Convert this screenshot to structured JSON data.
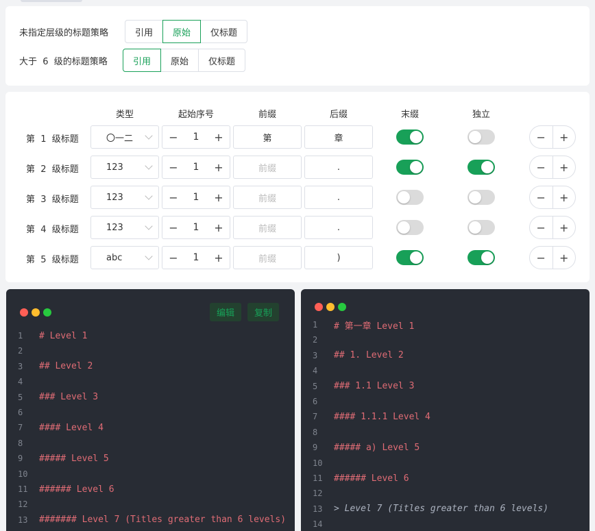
{
  "heading_strategy": {
    "unspecified": {
      "label": "未指定层级的标题策略",
      "options": [
        "引用",
        "原始",
        "仅标题"
      ],
      "selected": "原始"
    },
    "beyond6": {
      "label": "大于  6  级的标题策略",
      "options": [
        "引用",
        "原始",
        "仅标题"
      ],
      "selected": "引用"
    }
  },
  "table": {
    "headers": {
      "type": "类型",
      "start": "起始序号",
      "prefix": "前缀",
      "suffix": "后缀",
      "trailing": "末缀",
      "independent": "独立"
    },
    "rows": [
      {
        "label": "第  1  级标题",
        "type": "〇一二",
        "start": "1",
        "prefix": "第",
        "prefix_placeholder": false,
        "suffix": "章",
        "trailing": true,
        "independent": false
      },
      {
        "label": "第  2  级标题",
        "type": "123",
        "start": "1",
        "prefix": "前缀",
        "prefix_placeholder": true,
        "suffix": ".",
        "trailing": true,
        "independent": true
      },
      {
        "label": "第  3  级标题",
        "type": "123",
        "start": "1",
        "prefix": "前缀",
        "prefix_placeholder": true,
        "suffix": ".",
        "trailing": false,
        "independent": false
      },
      {
        "label": "第  4  级标题",
        "type": "123",
        "start": "1",
        "prefix": "前缀",
        "prefix_placeholder": true,
        "suffix": ".",
        "trailing": false,
        "independent": false
      },
      {
        "label": "第  5  级标题",
        "type": "abc",
        "start": "1",
        "prefix": "前缀",
        "prefix_placeholder": true,
        "suffix": ")",
        "trailing": true,
        "independent": true
      }
    ]
  },
  "editor": {
    "edit_label": "编辑",
    "copy_label": "复制",
    "lines": [
      {
        "n": "1",
        "text": "# Level 1"
      },
      {
        "n": "2",
        "text": ""
      },
      {
        "n": "3",
        "text": "## Level 2"
      },
      {
        "n": "4",
        "text": ""
      },
      {
        "n": "5",
        "text": "### Level 3"
      },
      {
        "n": "6",
        "text": ""
      },
      {
        "n": "7",
        "text": "#### Level 4"
      },
      {
        "n": "8",
        "text": ""
      },
      {
        "n": "9",
        "text": "##### Level 5"
      },
      {
        "n": "10",
        "text": ""
      },
      {
        "n": "11",
        "text": "###### Level 6"
      },
      {
        "n": "12",
        "text": ""
      },
      {
        "n": "13",
        "text": "####### Level 7 (Titles greater than 6 levels)"
      }
    ]
  },
  "preview": {
    "lines": [
      {
        "n": "1",
        "text": "# 第一章 Level 1",
        "style": "heading"
      },
      {
        "n": "2",
        "text": "",
        "style": "heading"
      },
      {
        "n": "3",
        "text": "## 1. Level 2",
        "style": "heading"
      },
      {
        "n": "4",
        "text": "",
        "style": "heading"
      },
      {
        "n": "5",
        "text": "### 1.1 Level 3",
        "style": "heading"
      },
      {
        "n": "6",
        "text": "",
        "style": "heading"
      },
      {
        "n": "7",
        "text": "#### 1.1.1 Level 4",
        "style": "heading"
      },
      {
        "n": "8",
        "text": "",
        "style": "heading"
      },
      {
        "n": "9",
        "text": "##### a) Level 5",
        "style": "heading"
      },
      {
        "n": "10",
        "text": "",
        "style": "heading"
      },
      {
        "n": "11",
        "text": "###### Level 6",
        "style": "heading"
      },
      {
        "n": "12",
        "text": "",
        "style": "heading"
      },
      {
        "n": "13",
        "text": "> Level 7 (Titles greater than 6 levels)",
        "style": "quote"
      },
      {
        "n": "14",
        "text": "",
        "style": "heading"
      }
    ]
  },
  "colors": {
    "accent": "#18a058",
    "code_bg": "#282c34",
    "heading_text": "#e06c75",
    "dot_red": "#ff5f56",
    "dot_yellow": "#ffbd2e",
    "dot_green": "#27c93f"
  }
}
